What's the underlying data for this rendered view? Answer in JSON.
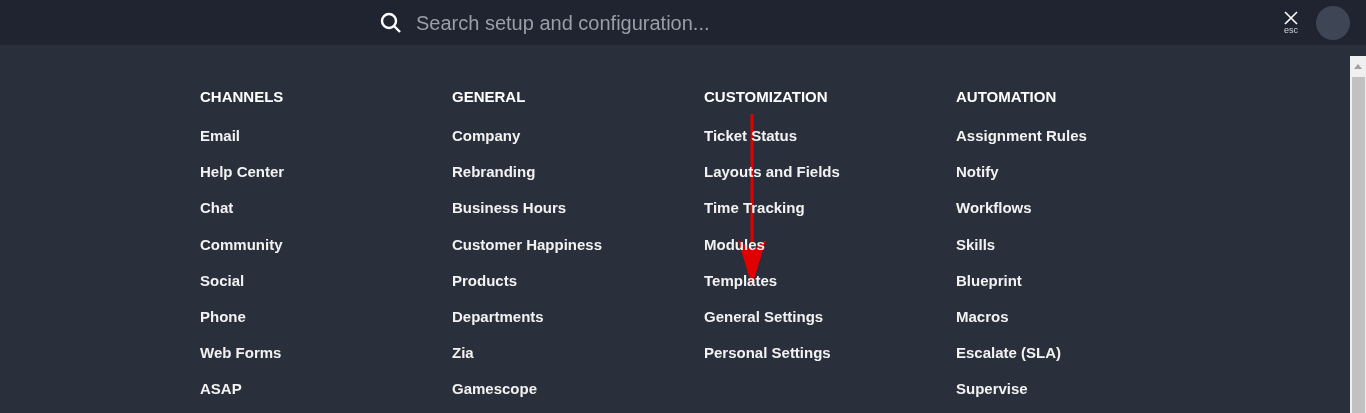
{
  "setup_search": {
    "placeholder": "Search setup and configuration..."
  },
  "close": {
    "hint": "esc"
  },
  "setup_menu": [
    {
      "heading": "CHANNELS",
      "items": [
        "Email",
        "Help Center",
        "Chat",
        "Community",
        "Social",
        "Phone",
        "Web Forms",
        "ASAP"
      ]
    },
    {
      "heading": "GENERAL",
      "items": [
        "Company",
        "Rebranding",
        "Business Hours",
        "Customer Happiness",
        "Products",
        "Departments",
        "Zia",
        "Gamescope"
      ]
    },
    {
      "heading": "CUSTOMIZATION",
      "items": [
        "Ticket Status",
        "Layouts and Fields",
        "Time Tracking",
        "Modules",
        "Templates",
        "General Settings",
        "Personal Settings"
      ]
    },
    {
      "heading": "AUTOMATION",
      "items": [
        "Assignment Rules",
        "Notify",
        "Workflows",
        "Skills",
        "Blueprint",
        "Macros",
        "Escalate (SLA)",
        "Supervise"
      ]
    }
  ]
}
